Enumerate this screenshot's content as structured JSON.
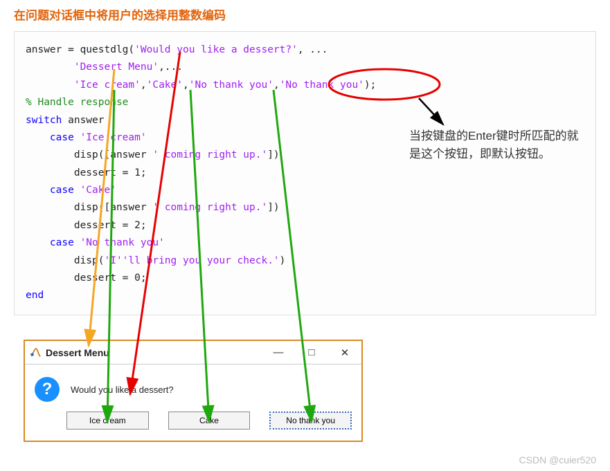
{
  "heading": "在问题对话框中将用户的选择用整数编码",
  "code": {
    "l1a": "answer = questdlg(",
    "l1s": "'Would you like a dessert?'",
    "l1b": ", ...",
    "l2a": "        ",
    "l2s": "'Dessert Menu'",
    "l2b": ",...",
    "l3a": "        ",
    "l3s1": "'Ice cream'",
    "l3m1": ",",
    "l3s2": "'Cake'",
    "l3m2": ",",
    "l3s3": "'No thank you'",
    "l3m3": ",",
    "l3s4": "'No thank you'",
    "l3b": ");",
    "l4": "% Handle response",
    "l5a": "switch",
    "l5b": " answer",
    "l6a": "    case",
    "l6s": " 'Ice cream'",
    "l7a": "        disp([answer ",
    "l7s": "' coming right up.'",
    "l7b": "])",
    "l8": "        dessert = 1;",
    "l9a": "    case",
    "l9s": " 'Cake'",
    "l10a": "        disp([answer ",
    "l10s": "' coming right up.'",
    "l10b": "])",
    "l11": "        dessert = 2;",
    "l12a": "    case",
    "l12s": " 'No thank you'",
    "l13a": "        disp(",
    "l13s": "'I''ll bring you your check.'",
    "l13b": ")",
    "l14": "        dessert = 0;",
    "l15": "end"
  },
  "annotation": "当按键盘的Enter键时所匹配的就是这个按钮，即默认按钮。",
  "dialog": {
    "title": "Dessert Menu",
    "question_mark": "?",
    "body_text": "Would you like a dessert?",
    "buttons": {
      "b1": "Ice cream",
      "b2": "Cake",
      "b3": "No thank you"
    },
    "window_controls": {
      "min": "—",
      "max": "□",
      "close": "✕"
    }
  },
  "watermark": "CSDN @cuier520"
}
